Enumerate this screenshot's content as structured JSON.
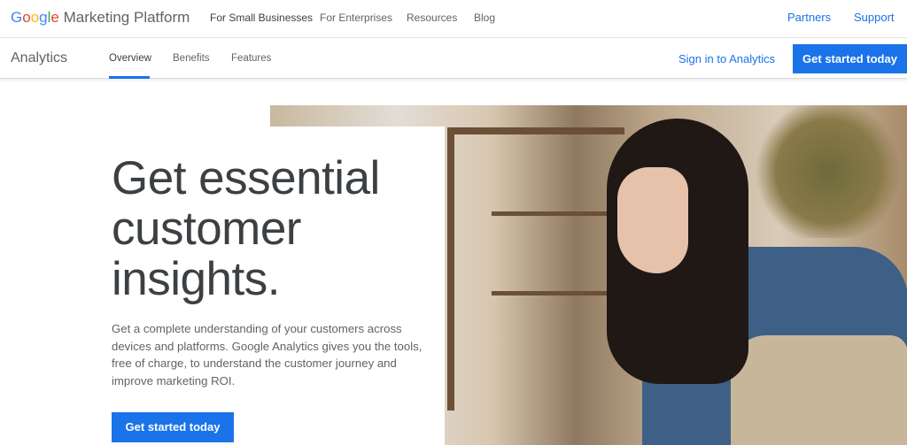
{
  "header": {
    "logo": {
      "google": "Google",
      "product_suite": "Marketing Platform"
    },
    "nav": [
      "For Small Businesses",
      "For Enterprises",
      "Resources",
      "Blog"
    ],
    "right_links": [
      "Partners",
      "Support"
    ]
  },
  "subheader": {
    "product": "Analytics",
    "tabs": [
      {
        "label": "Overview",
        "active": true
      },
      {
        "label": "Benefits",
        "active": false
      },
      {
        "label": "Features",
        "active": false
      }
    ],
    "sign_in": "Sign in to Analytics",
    "cta": "Get started today"
  },
  "hero": {
    "title_lines": [
      "Get essential",
      "customer",
      "insights."
    ],
    "description": "Get a complete understanding of your customers across devices and platforms. Google Analytics gives you the tools, free of charge, to understand the customer journey and improve marketing ROI.",
    "cta": "Get started today",
    "image_alt": "Woman working on a laptop in a shop"
  },
  "colors": {
    "accent": "#1a73e8",
    "text": "#3c4043",
    "muted": "#5f6368"
  }
}
